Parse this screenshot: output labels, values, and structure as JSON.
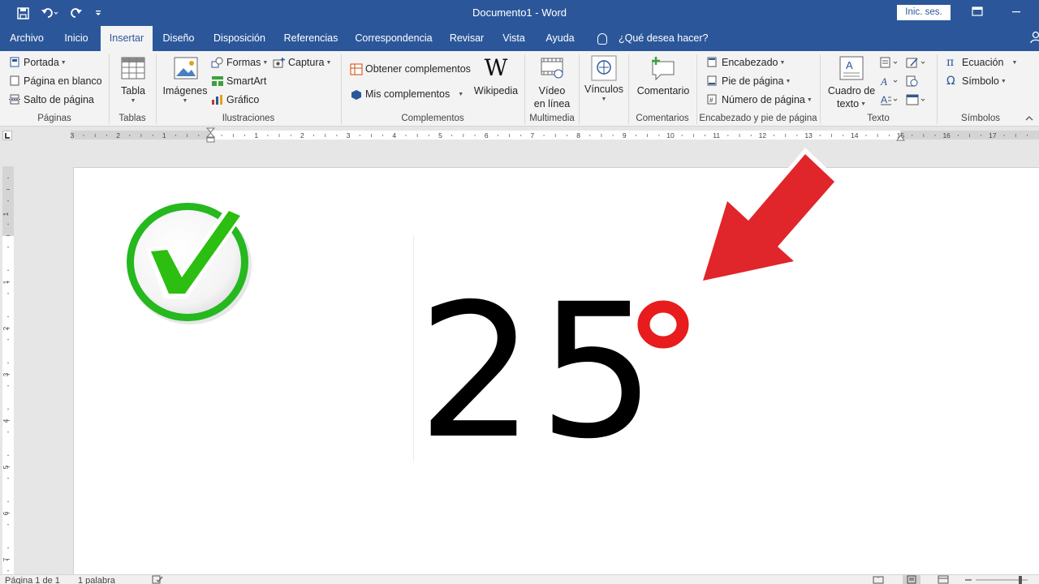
{
  "titlebar": {
    "title": "Documento1  -  Word",
    "signin_label": "Inic. ses.",
    "qat_icons": [
      "save-icon",
      "undo-icon",
      "redo-icon",
      "customize-icon"
    ]
  },
  "tabs": [
    {
      "label": "Archivo"
    },
    {
      "label": "Inicio"
    },
    {
      "label": "Insertar"
    },
    {
      "label": "Diseño"
    },
    {
      "label": "Disposición"
    },
    {
      "label": "Referencias"
    },
    {
      "label": "Correspondencia"
    },
    {
      "label": "Revisar"
    },
    {
      "label": "Vista"
    },
    {
      "label": "Ayuda"
    }
  ],
  "tell_me": "¿Qué desea hacer?",
  "ribbon": {
    "paginas": {
      "portada": "Portada",
      "en_blanco": "Página en blanco",
      "salto": "Salto de página",
      "group": "Páginas"
    },
    "tablas": {
      "tabla": "Tabla",
      "group": "Tablas"
    },
    "ilustraciones": {
      "imagenes": "Imágenes",
      "formas": "Formas",
      "smartart": "SmartArt",
      "grafico": "Gráfico",
      "captura": "Captura",
      "group": "Ilustraciones"
    },
    "complementos": {
      "obtener": "Obtener complementos",
      "mis": "Mis complementos",
      "wikipedia": "Wikipedia",
      "group": "Complementos"
    },
    "multimedia": {
      "video_1": "Vídeo",
      "video_2": "en línea",
      "group": "Multimedia"
    },
    "vinculos": {
      "label": "Vínculos"
    },
    "comentarios": {
      "comentario": "Comentario",
      "group": "Comentarios"
    },
    "encabezado": {
      "encabezado": "Encabezado",
      "pie": "Pie de página",
      "numero": "Número de página",
      "group": "Encabezado y pie de página"
    },
    "texto": {
      "cuadro_1": "Cuadro de",
      "cuadro_2": "texto",
      "group": "Texto"
    },
    "simbolos": {
      "ecuacion": "Ecuación",
      "simbolo": "Símbolo",
      "group": "Símbolos"
    }
  },
  "ruler": {
    "numbers": [
      "3",
      "2",
      "1",
      "1",
      "2",
      "3",
      "4",
      "5",
      "6",
      "7",
      "8",
      "9",
      "10",
      "11",
      "12",
      "13",
      "14",
      "15",
      "16",
      "17"
    ]
  },
  "vruler": {
    "numbers": [
      "1",
      "1",
      "2",
      "3",
      "4",
      "5",
      "6",
      "7"
    ]
  },
  "document": {
    "number": "25",
    "accent_color": "#e81c1c",
    "check_color": "#22b422"
  },
  "statusbar": {
    "page": "Página 1 de 1",
    "words": "1 palabra"
  },
  "colors": {
    "brand": "#2b579a",
    "ribbon_bg": "#f3f3f3"
  }
}
